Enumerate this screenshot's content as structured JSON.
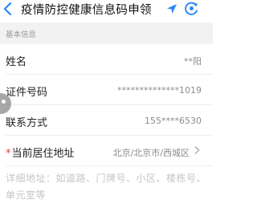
{
  "header": {
    "title": "疫情防控健康信息码申领",
    "back_icon": "chevron-left-icon",
    "nav_icon": "location-arrow-icon",
    "refresh_icon": "refresh-circle-icon",
    "accent_color": "#2b86f5"
  },
  "section": {
    "title": "基本信息"
  },
  "fields": {
    "name": {
      "label": "姓名",
      "value": "**阳"
    },
    "id_number": {
      "label": "证件号码",
      "value": "**************1019"
    },
    "phone": {
      "label": "联系方式",
      "value": "155****6530"
    },
    "residence": {
      "required_mark": "*",
      "label": "当前居住地址",
      "value": "北京/北京市/西城区"
    }
  },
  "address_detail": {
    "placeholder": "详细地址：如道路、门牌号、小区、楼栋号、单元室等"
  }
}
